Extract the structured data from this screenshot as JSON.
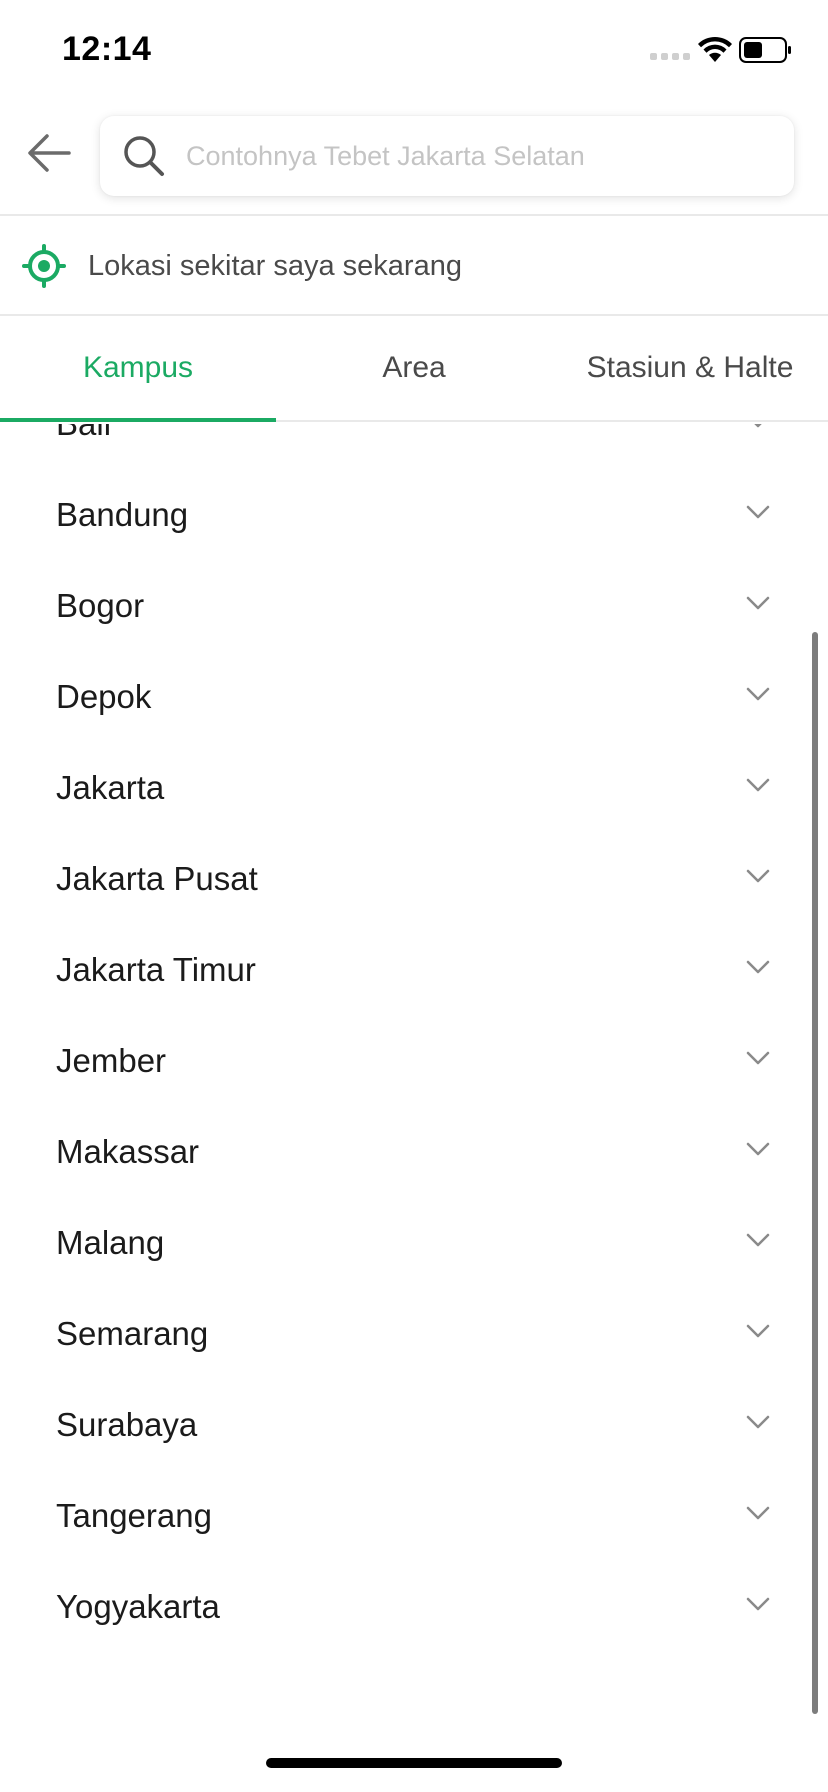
{
  "status_bar": {
    "time": "12:14"
  },
  "search": {
    "placeholder": "Contohnya Tebet Jakarta Selatan",
    "value": ""
  },
  "location": {
    "label": "Lokasi sekitar saya sekarang"
  },
  "tabs": [
    {
      "label": "Kampus",
      "active": true
    },
    {
      "label": "Area",
      "active": false
    },
    {
      "label": "Stasiun & Halte",
      "active": false
    }
  ],
  "cities": [
    "Bali",
    "Bandung",
    "Bogor",
    "Depok",
    "Jakarta",
    "Jakarta Pusat",
    "Jakarta Timur",
    "Jember",
    "Makassar",
    "Malang",
    "Semarang",
    "Surabaya",
    "Tangerang",
    "Yogyakarta"
  ],
  "colors": {
    "accent": "#1baa63",
    "text_primary": "#1b1b1b",
    "text_secondary": "#4a4a4a",
    "placeholder": "#c4c4c4",
    "divider": "#e9e9e9"
  },
  "icons": {
    "back": "arrow-left-icon",
    "search": "search-icon",
    "location": "target-icon",
    "expand": "chevron-down-icon"
  }
}
